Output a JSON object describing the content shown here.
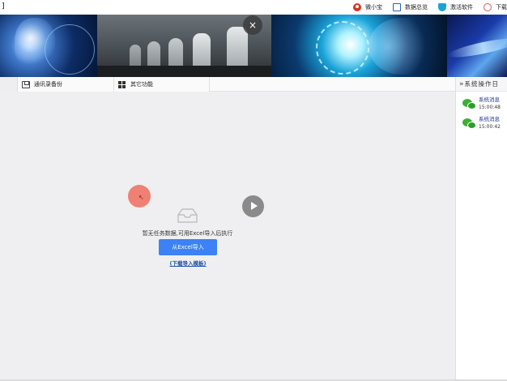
{
  "topbar": {
    "left_glyph": "]",
    "nav": [
      {
        "label": "微小宝",
        "icon": "user-icon"
      },
      {
        "label": "数据总览",
        "icon": "document-icon"
      },
      {
        "label": "激活软件",
        "icon": "shield-icon"
      },
      {
        "label": "下载",
        "icon": "download-icon"
      }
    ]
  },
  "banner": {
    "close_label": "×"
  },
  "tabs": [
    {
      "label": "通讯录备份",
      "icon": "save-icon"
    },
    {
      "label": "其它功能",
      "icon": "windows-icon"
    }
  ],
  "side_panel": {
    "header": "系统操作日",
    "chevron": "»",
    "logs": [
      {
        "title": "系统消息",
        "time": "15:00:48",
        "icon": "wechat-icon"
      },
      {
        "title": "系统消息",
        "time": "15:00:42",
        "icon": "wechat-icon"
      }
    ]
  },
  "main": {
    "empty_message": "暂无任务数据,可用Excel导入后执行",
    "import_button": "从Excel导入",
    "template_link": "(下载导入模板)"
  },
  "colors": {
    "accent": "#3d82f4",
    "cursor_marker": "#f07f74",
    "wechat_green": "#3cb034"
  }
}
